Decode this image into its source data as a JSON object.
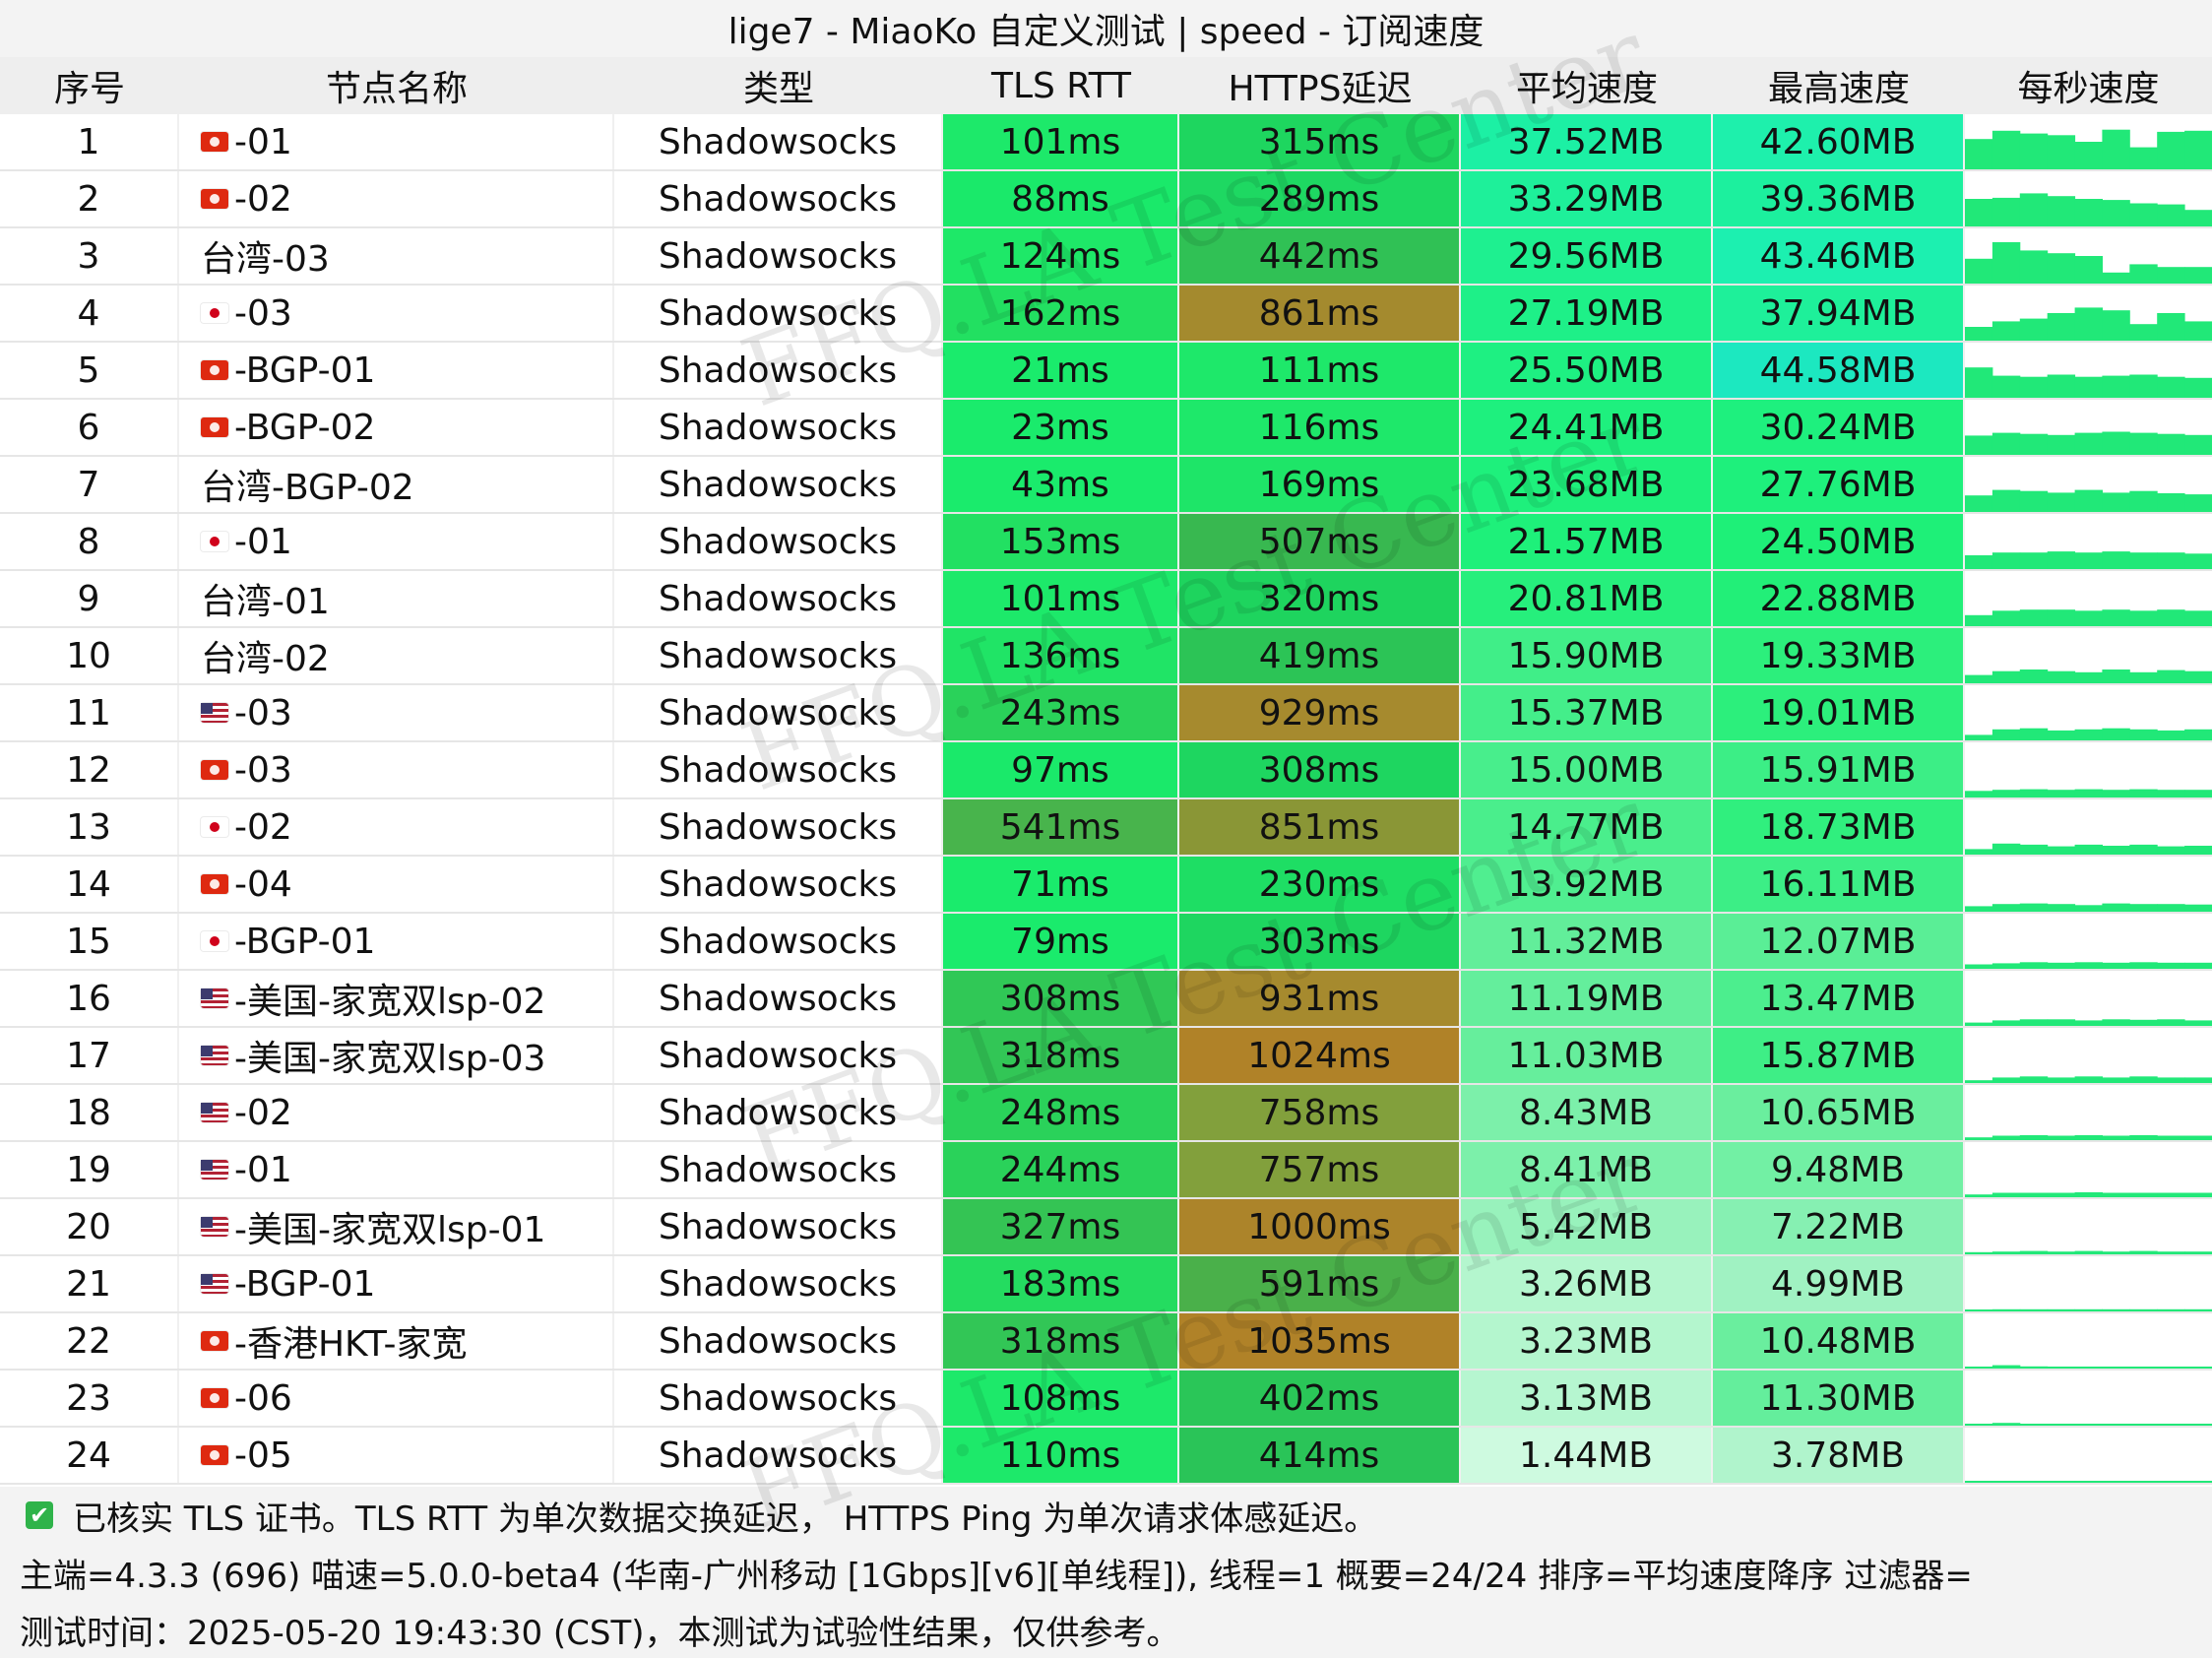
{
  "title": "lige7 - MiaoKo 自定义测试 | speed - 订阅速度",
  "columns": [
    "序号",
    "节点名称",
    "类型",
    "TLS RTT",
    "HTTPS延迟",
    "平均速度",
    "最高速度",
    "每秒速度"
  ],
  "rows": [
    {
      "idx": "1",
      "flag": "hk",
      "name": "-01",
      "type": "Shadowsocks",
      "tls": "101ms",
      "https": "315ms",
      "avg": "37.52MB",
      "max": "42.60MB",
      "spark": [
        0.55,
        0.7,
        0.65,
        0.62,
        0.5,
        0.72,
        0.4,
        0.68,
        0.7
      ],
      "colors": {
        "tls": "#1de96a",
        "https": "#1ed65f",
        "avg": "#1cf0a4",
        "max": "#1ef0ac"
      }
    },
    {
      "idx": "2",
      "flag": "hk",
      "name": "-02",
      "type": "Shadowsocks",
      "tls": "88ms",
      "https": "289ms",
      "avg": "33.29MB",
      "max": "39.36MB",
      "spark": [
        0.5,
        0.52,
        0.6,
        0.55,
        0.5,
        0.48,
        0.42,
        0.4,
        0.3
      ],
      "colors": {
        "tls": "#1ae96a",
        "https": "#1ed862",
        "avg": "#1ef09a",
        "max": "#1cf09e"
      }
    },
    {
      "idx": "3",
      "flag": "",
      "name": "台湾-03",
      "type": "Shadowsocks",
      "tls": "124ms",
      "https": "442ms",
      "avg": "29.56MB",
      "max": "43.46MB",
      "spark": [
        0.45,
        0.75,
        0.6,
        0.55,
        0.5,
        0.2,
        0.35,
        0.3,
        0.3
      ],
      "colors": {
        "tls": "#1ee868",
        "https": "#30c155",
        "avg": "#1ef090",
        "max": "#1cf0b0"
      }
    },
    {
      "idx": "4",
      "flag": "jp",
      "name": "-03",
      "type": "Shadowsocks",
      "tls": "162ms",
      "https": "861ms",
      "avg": "27.19MB",
      "max": "37.94MB",
      "spark": [
        0.25,
        0.35,
        0.4,
        0.5,
        0.6,
        0.55,
        0.3,
        0.5,
        0.35
      ],
      "colors": {
        "tls": "#22e061",
        "https": "#a48a2e",
        "avg": "#1ef088",
        "max": "#1ef09a"
      }
    },
    {
      "idx": "5",
      "flag": "hk",
      "name": "-BGP-01",
      "type": "Shadowsocks",
      "tls": "21ms",
      "https": "111ms",
      "avg": "25.50MB",
      "max": "44.58MB",
      "spark": [
        0.55,
        0.4,
        0.38,
        0.42,
        0.38,
        0.4,
        0.42,
        0.38,
        0.36
      ],
      "colors": {
        "tls": "#1aeb6c",
        "https": "#1ee86a",
        "avg": "#1ef082",
        "max": "#1ce8c0"
      }
    },
    {
      "idx": "6",
      "flag": "hk",
      "name": "-BGP-02",
      "type": "Shadowsocks",
      "tls": "23ms",
      "https": "116ms",
      "avg": "24.41MB",
      "max": "30.24MB",
      "spark": [
        0.35,
        0.4,
        0.38,
        0.36,
        0.4,
        0.42,
        0.4,
        0.38,
        0.36
      ],
      "colors": {
        "tls": "#1aeb6c",
        "https": "#1ee86a",
        "avg": "#1ef07e",
        "max": "#1ef07e"
      }
    },
    {
      "idx": "7",
      "flag": "",
      "name": "台湾-BGP-02",
      "type": "Shadowsocks",
      "tls": "43ms",
      "https": "169ms",
      "avg": "23.68MB",
      "max": "27.76MB",
      "spark": [
        0.3,
        0.4,
        0.38,
        0.35,
        0.4,
        0.35,
        0.38,
        0.34,
        0.32
      ],
      "colors": {
        "tls": "#1aeb6c",
        "https": "#1ee568",
        "avg": "#1ef07c",
        "max": "#1ef07c"
      }
    },
    {
      "idx": "8",
      "flag": "jp",
      "name": "-01",
      "type": "Shadowsocks",
      "tls": "153ms",
      "https": "507ms",
      "avg": "21.57MB",
      "max": "24.50MB",
      "spark": [
        0.25,
        0.3,
        0.3,
        0.32,
        0.3,
        0.32,
        0.3,
        0.3,
        0.28
      ],
      "colors": {
        "tls": "#22e062",
        "https": "#38b850",
        "avg": "#1ef07a",
        "max": "#1ef078"
      }
    },
    {
      "idx": "9",
      "flag": "",
      "name": "台湾-01",
      "type": "Shadowsocks",
      "tls": "101ms",
      "https": "320ms",
      "avg": "20.81MB",
      "max": "22.88MB",
      "spark": [
        0.2,
        0.28,
        0.3,
        0.3,
        0.28,
        0.3,
        0.28,
        0.3,
        0.28
      ],
      "colors": {
        "tls": "#1de96a",
        "https": "#1ed45e",
        "avg": "#26ef7c",
        "max": "#22ef78"
      }
    },
    {
      "idx": "10",
      "flag": "",
      "name": "台湾-02",
      "type": "Shadowsocks",
      "tls": "136ms",
      "https": "419ms",
      "avg": "15.90MB",
      "max": "19.33MB",
      "spark": [
        0.15,
        0.22,
        0.25,
        0.22,
        0.2,
        0.25,
        0.2,
        0.24,
        0.22
      ],
      "colors": {
        "tls": "#20e466",
        "https": "#2cc456",
        "avg": "#40ee88",
        "max": "#2cef7c"
      }
    },
    {
      "idx": "11",
      "flag": "us",
      "name": "-03",
      "type": "Shadowsocks",
      "tls": "243ms",
      "https": "929ms",
      "avg": "15.37MB",
      "max": "19.01MB",
      "spark": [
        0.1,
        0.2,
        0.22,
        0.18,
        0.2,
        0.22,
        0.2,
        0.18,
        0.2
      ],
      "colors": {
        "tls": "#2ad25a",
        "https": "#a68a2e",
        "avg": "#44ee8a",
        "max": "#2cef7c"
      }
    },
    {
      "idx": "12",
      "flag": "hk",
      "name": "-03",
      "type": "Shadowsocks",
      "tls": "97ms",
      "https": "308ms",
      "avg": "15.00MB",
      "max": "15.91MB",
      "spark": [
        0.12,
        0.14,
        0.15,
        0.14,
        0.15,
        0.14,
        0.15,
        0.14,
        0.14
      ],
      "colors": {
        "tls": "#1ae96a",
        "https": "#1ed660",
        "avg": "#48ee8c",
        "max": "#3cee86"
      }
    },
    {
      "idx": "13",
      "flag": "jp",
      "name": "-02",
      "type": "Shadowsocks",
      "tls": "541ms",
      "https": "851ms",
      "avg": "14.77MB",
      "max": "18.73MB",
      "spark": [
        0.1,
        0.2,
        0.18,
        0.15,
        0.18,
        0.16,
        0.18,
        0.15,
        0.16
      ],
      "colors": {
        "tls": "#48b44c",
        "https": "#8a9636",
        "avg": "#4aee8c",
        "max": "#30ef7e"
      }
    },
    {
      "idx": "14",
      "flag": "hk",
      "name": "-04",
      "type": "Shadowsocks",
      "tls": "71ms",
      "https": "230ms",
      "avg": "13.92MB",
      "max": "16.11MB",
      "spark": [
        0.1,
        0.14,
        0.15,
        0.14,
        0.12,
        0.15,
        0.14,
        0.14,
        0.13
      ],
      "colors": {
        "tls": "#1aeb6c",
        "https": "#1ede64",
        "avg": "#50ee90",
        "max": "#3cee86"
      }
    },
    {
      "idx": "15",
      "flag": "jp",
      "name": "-BGP-01",
      "type": "Shadowsocks",
      "tls": "79ms",
      "https": "303ms",
      "avg": "11.32MB",
      "max": "12.07MB",
      "spark": [
        0.08,
        0.1,
        0.12,
        0.11,
        0.12,
        0.11,
        0.12,
        0.11,
        0.11
      ],
      "colors": {
        "tls": "#1aeb6c",
        "https": "#1ed660",
        "avg": "#62ee9a",
        "max": "#5aee96"
      }
    },
    {
      "idx": "16",
      "flag": "us",
      "name": "-美国-家宽双lsp-02",
      "type": "Shadowsocks",
      "tls": "308ms",
      "https": "931ms",
      "avg": "11.19MB",
      "max": "13.47MB",
      "spark": [
        0.06,
        0.1,
        0.12,
        0.12,
        0.1,
        0.12,
        0.11,
        0.12,
        0.1
      ],
      "colors": {
        "tls": "#30c856",
        "https": "#a68a2e",
        "avg": "#64ee9c",
        "max": "#4cee8e"
      }
    },
    {
      "idx": "17",
      "flag": "us",
      "name": "-美国-家宽双lsp-03",
      "type": "Shadowsocks",
      "tls": "318ms",
      "https": "1024ms",
      "avg": "11.03MB",
      "max": "15.87MB",
      "spark": [
        0.05,
        0.1,
        0.12,
        0.1,
        0.12,
        0.1,
        0.12,
        0.1,
        0.1
      ],
      "colors": {
        "tls": "#32c656",
        "https": "#b08228",
        "avg": "#66ee9c",
        "max": "#3eee86"
      }
    },
    {
      "idx": "18",
      "flag": "us",
      "name": "-02",
      "type": "Shadowsocks",
      "tls": "248ms",
      "https": "758ms",
      "avg": "8.43MB",
      "max": "10.65MB",
      "spark": [
        0.05,
        0.08,
        0.09,
        0.08,
        0.09,
        0.08,
        0.09,
        0.08,
        0.08
      ],
      "colors": {
        "tls": "#2ad25a",
        "https": "#82a03c",
        "avg": "#7cf0aa",
        "max": "#6aee9e"
      }
    },
    {
      "idx": "19",
      "flag": "us",
      "name": "-01",
      "type": "Shadowsocks",
      "tls": "244ms",
      "https": "757ms",
      "avg": "8.41MB",
      "max": "9.48MB",
      "spark": [
        0.05,
        0.08,
        0.08,
        0.08,
        0.09,
        0.08,
        0.08,
        0.08,
        0.08
      ],
      "colors": {
        "tls": "#2ad25a",
        "https": "#82a03c",
        "avg": "#7cf0aa",
        "max": "#72f0a4"
      }
    },
    {
      "idx": "20",
      "flag": "us",
      "name": "-美国-家宽双lsp-01",
      "type": "Shadowsocks",
      "tls": "327ms",
      "https": "1000ms",
      "avg": "5.42MB",
      "max": "7.22MB",
      "spark": [
        0.04,
        0.05,
        0.06,
        0.05,
        0.06,
        0.05,
        0.06,
        0.05,
        0.05
      ],
      "colors": {
        "tls": "#34c454",
        "https": "#ac842a",
        "avg": "#98f2bc",
        "max": "#86f0b2"
      }
    },
    {
      "idx": "21",
      "flag": "us",
      "name": "-BGP-01",
      "type": "Shadowsocks",
      "tls": "183ms",
      "https": "591ms",
      "avg": "3.26MB",
      "max": "4.99MB",
      "spark": [
        0.03,
        0.04,
        0.04,
        0.04,
        0.04,
        0.04,
        0.04,
        0.04,
        0.04
      ],
      "colors": {
        "tls": "#24dc60",
        "https": "#4ab04a",
        "avg": "#b4f6ce",
        "max": "#a0f2c2"
      }
    },
    {
      "idx": "22",
      "flag": "hk",
      "name": "-香港HKT-家宽",
      "type": "Shadowsocks",
      "tls": "318ms",
      "https": "1035ms",
      "avg": "3.23MB",
      "max": "10.48MB",
      "spark": [
        0.02,
        0.06,
        0.04,
        0.03,
        0.03,
        0.02,
        0.02,
        0.02,
        0.02
      ],
      "colors": {
        "tls": "#32c656",
        "https": "#b08228",
        "avg": "#b4f6ce",
        "max": "#6aee9e"
      }
    },
    {
      "idx": "23",
      "flag": "hk",
      "name": "-06",
      "type": "Shadowsocks",
      "tls": "108ms",
      "https": "402ms",
      "avg": "3.13MB",
      "max": "11.30MB",
      "spark": [
        0.02,
        0.05,
        0.03,
        0.02,
        0.02,
        0.02,
        0.02,
        0.02,
        0.02
      ],
      "colors": {
        "tls": "#1de96a",
        "https": "#2ac658",
        "avg": "#b6f6d0",
        "max": "#64ee9c"
      }
    },
    {
      "idx": "24",
      "flag": "hk",
      "name": "-05",
      "type": "Shadowsocks",
      "tls": "110ms",
      "https": "414ms",
      "avg": "1.44MB",
      "max": "3.78MB",
      "spark": [
        0.01,
        0.02,
        0.02,
        0.01,
        0.02,
        0.01,
        0.02,
        0.01,
        0.01
      ],
      "colors": {
        "tls": "#1de96a",
        "https": "#2ac458",
        "avg": "#cefae0",
        "max": "#b0f4cc"
      }
    }
  ],
  "footer": {
    "line1": "已核实 TLS 证书。TLS RTT 为单次数据交换延迟， HTTPS Ping 为单次请求体感延迟。",
    "line2": "主端=4.3.3 (696) 喵速=5.0.0-beta4 (华南-广州移动 [1Gbps][v6][单线程]), 线程=1 概要=24/24 排序=平均速度降序 过滤器=",
    "line3": "测试时间：2025-05-20 19:43:30 (CST)，本测试为试验性结果，仅供参考。"
  },
  "watermark": "FFQ.LA Test Center",
  "colors": {
    "spark": "#21e878",
    "header_bg": "#eeeeee",
    "footer_bg": "#f3f3f3"
  }
}
